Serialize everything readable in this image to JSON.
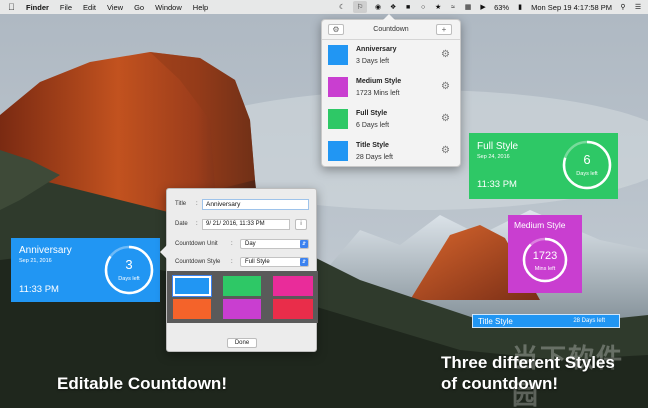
{
  "menubar": {
    "app_name": "Finder",
    "menus": [
      "File",
      "Edit",
      "View",
      "Go",
      "Window",
      "Help"
    ],
    "battery": "63%",
    "datetime": "Mon Sep 19  4:17:58 PM"
  },
  "popover": {
    "title": "Countdown",
    "add_label": "+",
    "items": [
      {
        "name": "Anniversary",
        "sub": "3 Days left",
        "color": "#2196f3"
      },
      {
        "name": "Medium Style",
        "sub": "1723 Mins left",
        "color": "#c93ed0"
      },
      {
        "name": "Full Style",
        "sub": "6 Days left",
        "color": "#2ec866"
      },
      {
        "name": "Title Style",
        "sub": "28 Days left",
        "color": "#2196f3"
      }
    ]
  },
  "full_widget": {
    "title": "Full Style",
    "date": "Sep 24, 2016",
    "time": "11:33 PM",
    "number": "6",
    "unit": "Days left",
    "color": "#2ec866",
    "progress": 0.8
  },
  "medium_widget": {
    "title": "Medium Style",
    "number": "1723",
    "unit": "Mins left",
    "color": "#c93ed0",
    "progress": 0.88
  },
  "anniv_widget": {
    "title": "Anniversary",
    "date": "Sep 21, 2016",
    "time": "11:33 PM",
    "number": "3",
    "unit": "Days left",
    "color": "#2196f3",
    "progress": 0.85
  },
  "title_widget": {
    "title": "Title Style",
    "days": "28 Days left",
    "color": "#2196f3"
  },
  "edit_panel": {
    "title_label": "Title",
    "title_value": "Anniversary",
    "date_label": "Date",
    "date_value": "9/ 21/ 2016, 11:33 PM",
    "info_label": "i",
    "unit_label": "Countdown Unit",
    "unit_value": "Day",
    "style_label": "Countdown Style",
    "style_value": "Full Style",
    "colon": ":",
    "swatches": [
      "#2196f3",
      "#2ec866",
      "#e92c9a",
      "#f4632a",
      "#c93ed0",
      "#e92d4a"
    ],
    "done_label": "Done"
  },
  "captions": {
    "left": "Editable Countdown!",
    "right_line1": "Three different Styles",
    "right_line2": "of countdown!",
    "watermark": "当下软件园"
  }
}
